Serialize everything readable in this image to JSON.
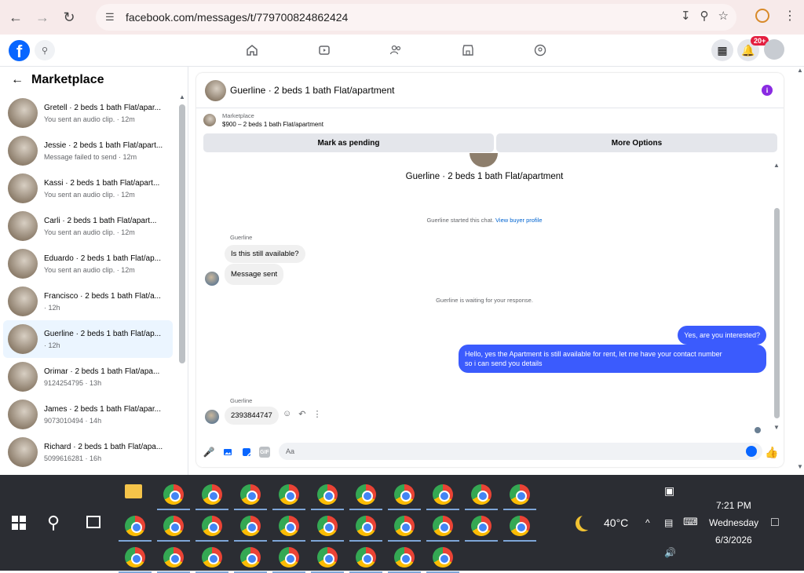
{
  "browser": {
    "url": "facebook.com/messages/t/779700824862424"
  },
  "fbnav": {
    "notif_badge": "20+"
  },
  "sidebar": {
    "title": "Marketplace",
    "conversations": [
      {
        "title": "Gretell · 2 beds 1 bath Flat/apar...",
        "sub": "You sent an audio clip. · 12m",
        "active": false
      },
      {
        "title": "Jessie · 2 beds 1 bath Flat/apart...",
        "sub": "Message failed to send · 12m",
        "active": false
      },
      {
        "title": "Kassi · 2 beds 1 bath Flat/apart...",
        "sub": "You sent an audio clip. · 12m",
        "active": false
      },
      {
        "title": "Carli · 2 beds 1 bath Flat/apart...",
        "sub": "You sent an audio clip. · 12m",
        "active": false
      },
      {
        "title": "Eduardo · 2 beds 1 bath Flat/ap...",
        "sub": "You sent an audio clip. · 12m",
        "active": false
      },
      {
        "title": "Francisco · 2 beds 1 bath Flat/a...",
        "sub": "· 12h",
        "active": false
      },
      {
        "title": "Guerline · 2 beds 1 bath Flat/ap...",
        "sub": "· 12h",
        "active": true
      },
      {
        "title": "Orimar · 2 beds 1 bath Flat/apa...",
        "sub": "9124254795 · 13h",
        "active": false
      },
      {
        "title": "James · 2 beds 1 bath Flat/apar...",
        "sub": "9073010494 · 14h",
        "active": false
      },
      {
        "title": "Richard · 2 beds 1 bath Flat/apa...",
        "sub": "5099616281 · 16h",
        "active": false
      }
    ]
  },
  "chat": {
    "header_name": "Guerline · 2 beds 1 bath Flat/apartment",
    "listing_label": "Marketplace",
    "listing_detail": "$900 – 2 beds 1 bath Flat/apartment",
    "btn_pending": "Mark as pending",
    "btn_more": "More Options",
    "center_name": "Guerline · 2 beds 1 bath Flat/apartment",
    "started_text": "Guerline started this chat.",
    "view_profile": "View buyer profile",
    "sender1": "Guerline",
    "msg_in_1": "Is this still available?",
    "msg_in_2": "Message sent",
    "waiting_text": "Guerline is waiting for your response.",
    "msg_out_1": "Yes, are you interested?",
    "msg_out_2_line1": "Hello, yes the Apartment is still available for rent, let me have your contact number",
    "msg_out_2_line2": "so i can send you details",
    "sender2": "Guerline",
    "msg_in_3": "2393844747",
    "composer_placeholder": "Aa",
    "gif_label": "GIF"
  },
  "taskbar": {
    "temperature": "40°C",
    "time": "7:21 PM",
    "day": "Wednesday",
    "date": "6/3/2026"
  },
  "colors": {
    "accent_blue": "#0866ff",
    "outgoing_bubble": "#3b5bfd",
    "notif_red": "#e41e3f",
    "info_purple": "#8a2be2"
  }
}
